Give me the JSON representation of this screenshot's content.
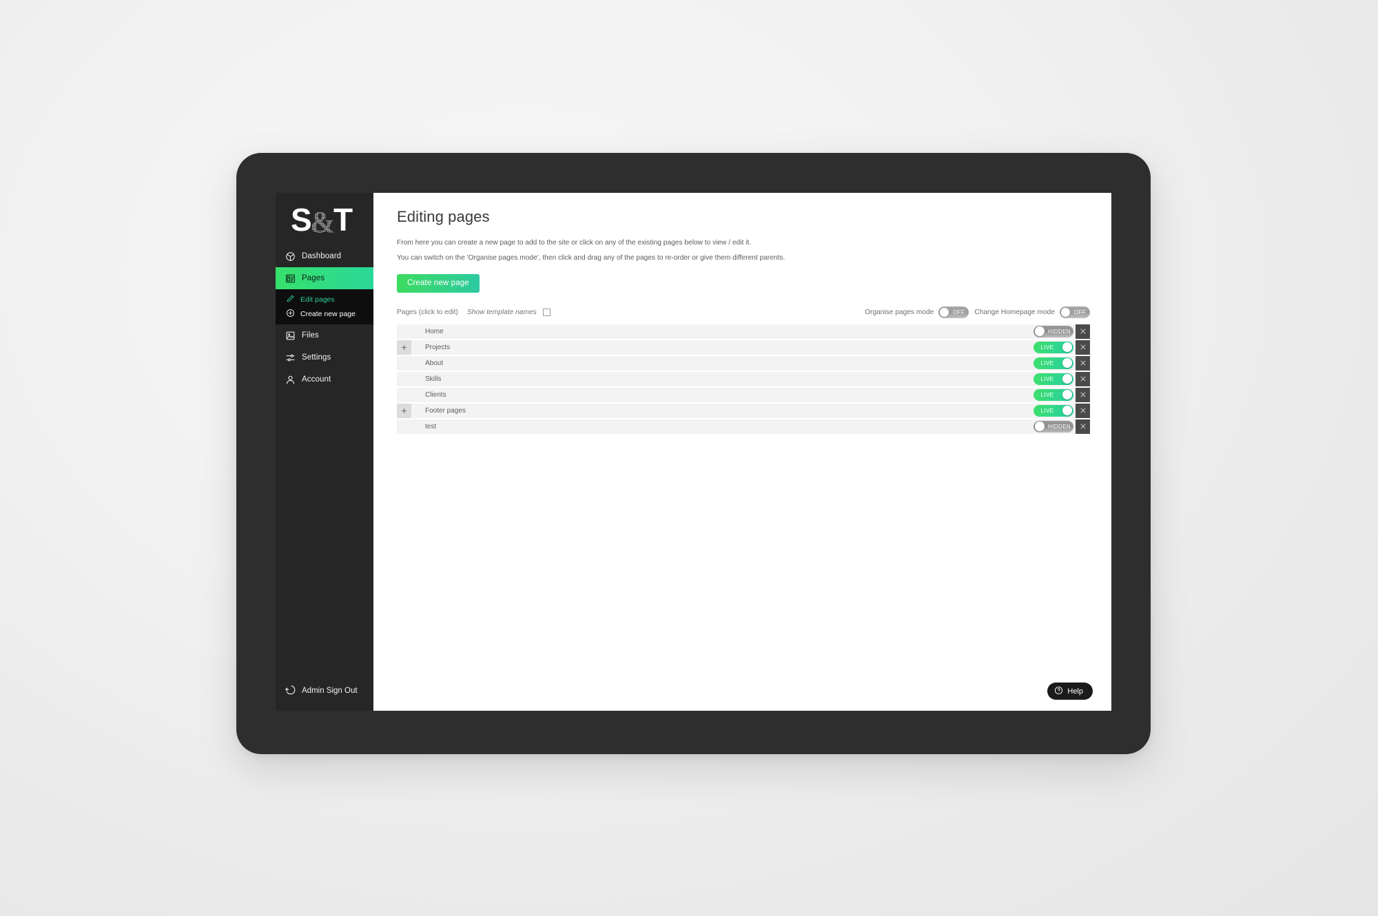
{
  "brand": {
    "logo_text": "S&T"
  },
  "sidebar": {
    "items": [
      {
        "label": "Dashboard",
        "icon": "dashboard-icon"
      },
      {
        "label": "Pages",
        "icon": "pages-icon",
        "active": true
      },
      {
        "label": "Files",
        "icon": "files-icon"
      },
      {
        "label": "Settings",
        "icon": "settings-icon"
      },
      {
        "label": "Account",
        "icon": "account-icon"
      }
    ],
    "submenu": [
      {
        "label": "Edit pages",
        "icon": "pencil-icon",
        "current": true
      },
      {
        "label": "Create new page",
        "icon": "plus-circle-icon",
        "current": false
      }
    ],
    "signout": {
      "label": "Admin Sign Out",
      "icon": "sign-out-icon"
    }
  },
  "main": {
    "title": "Editing pages",
    "description_line1": "From here you can create a new page to add to the site or click on any of the existing pages below to view / edit it.",
    "description_line2": "You can switch on the 'Organise pages mode', then click and drag any of the pages to re-order or give them different parents.",
    "create_button": "Create new page",
    "list_label": "Pages (click to edit)",
    "template_names_label": "Show template names",
    "template_names_checked": false,
    "modes": [
      {
        "label": "Organise pages mode",
        "state": "OFF"
      },
      {
        "label": "Change Homepage mode",
        "state": "OFF"
      }
    ],
    "pages": [
      {
        "name": "Home",
        "expandable": false,
        "status": "HIDDEN",
        "live": false
      },
      {
        "name": "Projects",
        "expandable": true,
        "status": "LIVE",
        "live": true
      },
      {
        "name": "About",
        "expandable": false,
        "status": "LIVE",
        "live": true
      },
      {
        "name": "Skills",
        "expandable": false,
        "status": "LIVE",
        "live": true
      },
      {
        "name": "Clients",
        "expandable": false,
        "status": "LIVE",
        "live": true
      },
      {
        "name": "Footer pages",
        "expandable": true,
        "status": "LIVE",
        "live": true
      },
      {
        "name": "test",
        "expandable": false,
        "status": "HIDDEN",
        "live": false
      }
    ],
    "help_button": "Help"
  },
  "colors": {
    "accent_green": "#3ddc5f",
    "accent_teal": "#2cc9a2",
    "sidebar_bg": "#262626",
    "submenu_bg": "#0e0e0e",
    "row_bg": "#f3f3f3",
    "delete_bg": "#4a4a4a"
  }
}
